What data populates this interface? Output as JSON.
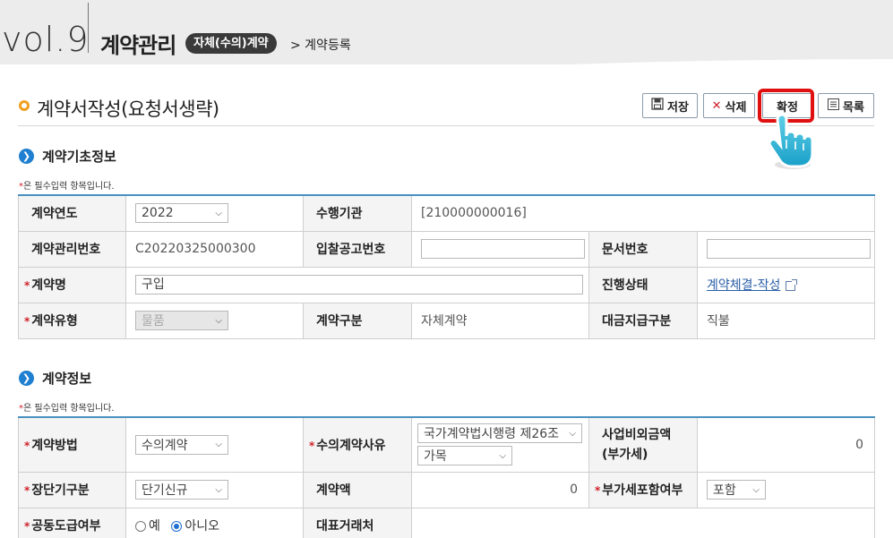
{
  "header": {
    "vol": "vol.9",
    "title": "계약관리",
    "badge": "자체(수의)계약",
    "breadcrumb": "> 계약등록"
  },
  "page": {
    "title": "계약서작성(요청서생략)"
  },
  "toolbar": {
    "save_label": "저장",
    "delete_label": "삭제",
    "confirm_label": "확정",
    "list_label": "목록"
  },
  "section_basic": {
    "title": "계약기초정보",
    "required_note": "은 필수입력 항목입니다.",
    "contract_year_label": "계약연도",
    "contract_year_value": "2022",
    "agency_label": "수행기관",
    "agency_value": "[210000000016]",
    "mgmt_no_label": "계약관리번호",
    "mgmt_no_value": "C20220325000300",
    "bid_notice_label": "입찰공고번호",
    "bid_notice_value": "",
    "doc_no_label": "문서번호",
    "doc_no_value": "",
    "name_label": "계약명",
    "name_value": "구입",
    "status_label": "진행상태",
    "status_value": "계약체결-작성",
    "type_label": "계약유형",
    "type_value": "물품",
    "category_label": "계약구분",
    "category_value": "자체계약",
    "payment_label": "대금지급구분",
    "payment_value": "직불"
  },
  "section_info": {
    "title": "계약정보",
    "required_note": "은 필수입력 항목입니다.",
    "method_label": "계약방법",
    "method_value": "수의계약",
    "reason_label": "수의계약사유",
    "reason_value_1": "국가계약법시행령 제26조 ;",
    "reason_value_2": "가목",
    "non_project_label_1": "사업비외금액",
    "non_project_label_2": "(부가세)",
    "non_project_value": "0",
    "term_label": "장단기구분",
    "term_value": "단기신규",
    "amount_label": "계약액",
    "amount_value": "0",
    "vat_label": "부가세포함여부",
    "vat_value": "포함",
    "joint_label": "공동도급여부",
    "joint_yes": "예",
    "joint_no": "아니오",
    "rep_label": "대표거래처",
    "rep_value": ""
  },
  "colors": {
    "accent": "#1f7fd0",
    "required": "#d0202a",
    "highlight": "#e01010",
    "title_dot": "#f0a020"
  },
  "icons": {
    "save": "floppy-icon",
    "delete": "x-icon",
    "list": "list-icon",
    "pointer": "hand-pointer-icon"
  }
}
